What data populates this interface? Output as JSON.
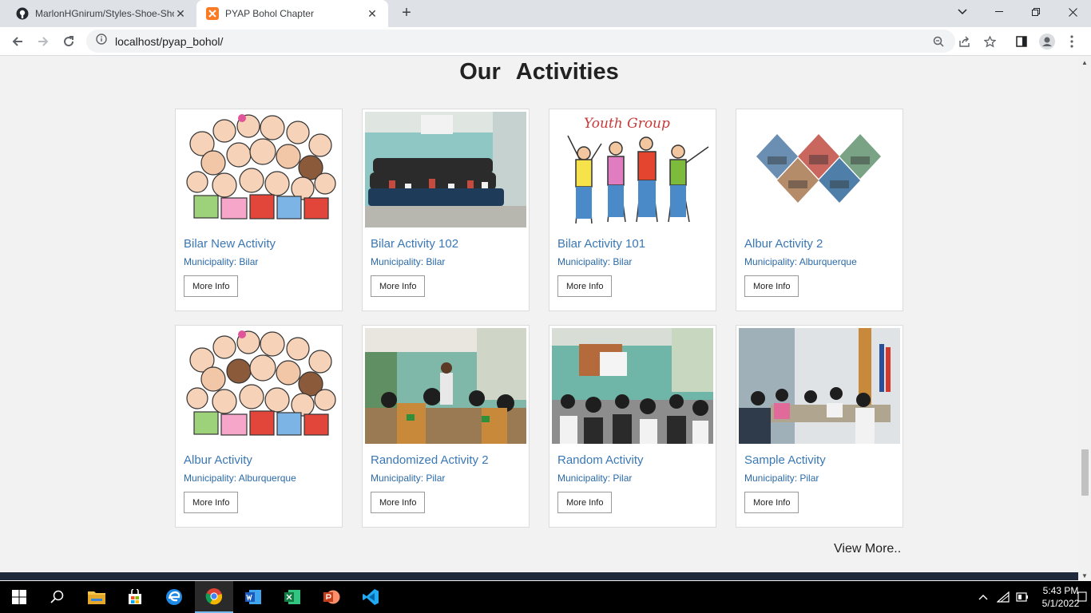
{
  "browser": {
    "tabs": [
      {
        "title": "MarlonHGnirum/Styles-Shoe-Sho",
        "active": false
      },
      {
        "title": "PYAP Bohol Chapter",
        "active": true
      }
    ],
    "url": "localhost/pyap_bohol/"
  },
  "page": {
    "section_title": "Our Activities",
    "button_label": "More Info",
    "view_more": "View More..",
    "activities": [
      {
        "name": "Bilar New Activity",
        "municipality": "Municipality: Bilar",
        "image": "cartoon-kids"
      },
      {
        "name": "Bilar Activity 102",
        "municipality": "Municipality: Bilar",
        "image": "group-photo"
      },
      {
        "name": "Bilar Activity 101",
        "municipality": "Municipality: Bilar",
        "image": "youth-group",
        "image_text": "Youth Group"
      },
      {
        "name": "Albur Activity 2",
        "municipality": "Municipality: Alburquerque",
        "image": "diamond-collage"
      },
      {
        "name": "Albur Activity",
        "municipality": "Municipality: Alburquerque",
        "image": "cartoon-kids"
      },
      {
        "name": "Randomized Activity 2",
        "municipality": "Municipality: Pilar",
        "image": "seminar-photo"
      },
      {
        "name": "Random Activity",
        "municipality": "Municipality: Pilar",
        "image": "classroom-photo"
      },
      {
        "name": "Sample Activity",
        "municipality": "Municipality: Pilar",
        "image": "meeting-photo"
      }
    ]
  },
  "taskbar": {
    "time": "5:43 PM",
    "date": "5/1/2022",
    "apps": [
      "start-icon",
      "search-icon",
      "file-explorer-icon",
      "store-icon",
      "edge-icon",
      "chrome-icon",
      "word-icon",
      "excel-icon",
      "powerpoint-icon",
      "vscode-icon"
    ]
  },
  "colors": {
    "link": "#3a78b6",
    "accent": "#2b6aa8"
  }
}
